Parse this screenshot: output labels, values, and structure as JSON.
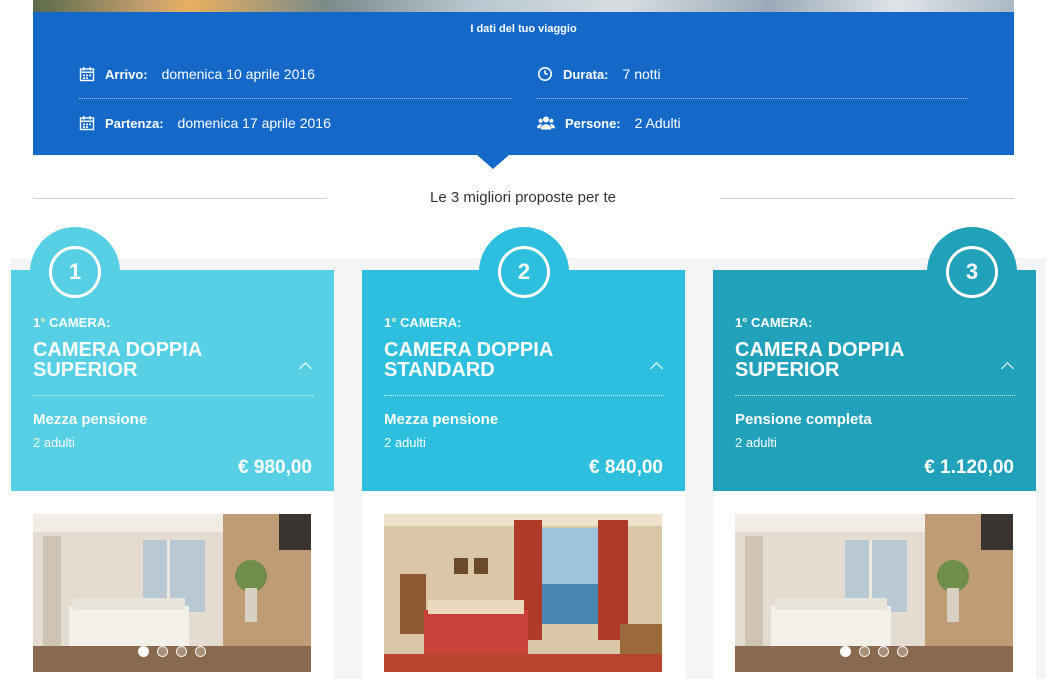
{
  "trip": {
    "title": "I dati del tuo viaggio",
    "arrival_label": "Arrivo:",
    "arrival_value": "domenica 10 aprile 2016",
    "departure_label": "Partenza:",
    "departure_value": "domenica 17 aprile 2016",
    "duration_label": "Durata:",
    "duration_value": "7 notti",
    "guests_label": "Persone:",
    "guests_value": "2 Adulti"
  },
  "heading": "Le 3 migliori proposte per te",
  "colors": {
    "trip_bg": "#1468c8",
    "card1": "#57d0e6",
    "card2": "#2dbfdd",
    "card3": "#21a2ba"
  },
  "offers": [
    {
      "rank": "1",
      "room_no": "1° CAMERA:",
      "room_name": "CAMERA DOPPIA SUPERIOR",
      "board": "Mezza pensione",
      "guests": "2 adulti",
      "price": "€ 980,00"
    },
    {
      "rank": "2",
      "room_no": "1° CAMERA:",
      "room_name": "CAMERA DOPPIA STANDARD",
      "board": "Mezza pensione",
      "guests": "2 adulti",
      "price": "€ 840,00"
    },
    {
      "rank": "3",
      "room_no": "1° CAMERA:",
      "room_name": "CAMERA DOPPIA SUPERIOR",
      "board": "Pensione completa",
      "guests": "2 adulti",
      "price": "€ 1.120,00"
    }
  ],
  "icons": {
    "calendar": "calendar-icon",
    "clock": "clock-icon",
    "people": "people-icon",
    "chevron": "chevron-up-icon"
  }
}
